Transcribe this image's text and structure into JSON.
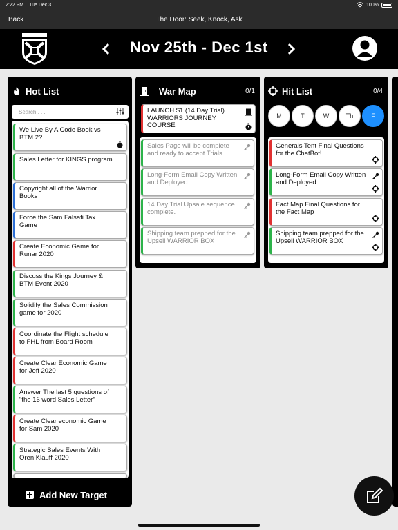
{
  "status_bar": {
    "time": "2:22 PM",
    "date": "Tue Dec 3",
    "battery": "100%"
  },
  "nav": {
    "back_label": "Back",
    "title": "The Door: Seek, Knock, Ask"
  },
  "header": {
    "date_range": "Nov 25th - Dec 1st"
  },
  "hot_list": {
    "title": "Hot List",
    "search_placeholder": "Search . . .",
    "add_label": "Add New Target",
    "items": [
      {
        "label": "We Live By A Code Book vs BTM 2?",
        "color": "green",
        "icon": "stopwatch-icon"
      },
      {
        "label": "Sales Letter for KINGS program",
        "color": "green"
      },
      {
        "label": "Copyright all of the Warrior Books",
        "color": "blue"
      },
      {
        "label": "Force the Sam Falsafi Tax Game",
        "color": "blue"
      },
      {
        "label": "Create Economic Game for Runar 2020",
        "color": "red"
      },
      {
        "label": "Discuss the Kings Journey & BTM Event 2020",
        "color": "green"
      },
      {
        "label": "Solidify the Sales Commission game for 2020",
        "color": "green"
      },
      {
        "label": "Coordinate the Flight schedule to FHL from Board Room",
        "color": "red"
      },
      {
        "label": "Create Clear Economic Game for Jeff 2020",
        "color": "red"
      },
      {
        "label": "Answer The last 5 questions of \"the 16 word Sales Letter\"",
        "color": "green"
      },
      {
        "label": "Create Clear economic Game for Sam 2020",
        "color": "red"
      },
      {
        "label": "Strategic Sales Events With Oren Klauff 2020",
        "color": "green"
      }
    ]
  },
  "war_map": {
    "title": "War Map",
    "count": "0/1",
    "pinned": {
      "label": "LAUNCH $1 (14 Day Trial) WARRIORS JOURNEY COURSE",
      "color": "red"
    },
    "items": [
      {
        "label": "Sales Page will be complete and ready to accept Trials.",
        "color": "green"
      },
      {
        "label": "Long-Form Email Copy Written and Deployed",
        "color": "green"
      },
      {
        "label": "14 Day Trial Upsale sequence complete.",
        "color": "green"
      },
      {
        "label": "Shipping team prepped for the Upsell WARRIOR BOX",
        "color": "green"
      }
    ]
  },
  "hit_list": {
    "title": "Hit List",
    "count": "0/4",
    "days": [
      "M",
      "T",
      "W",
      "Th",
      "F"
    ],
    "active_day": "F",
    "items": [
      {
        "label": "Generals Tent Final Questions for the ChatBot!",
        "color": "red"
      },
      {
        "label": "Long-Form Email Copy Written and Deployed",
        "color": "green"
      },
      {
        "label": "Fact Map Final Questions for the Fact Map",
        "color": "red"
      },
      {
        "label": "Shipping team prepped for the Upsell WARRIOR BOX",
        "color": "green"
      }
    ]
  },
  "colors": {
    "green": "#2db34a",
    "red": "#e03131",
    "blue": "#2c6fd6",
    "active_day": "#1e90ff"
  }
}
